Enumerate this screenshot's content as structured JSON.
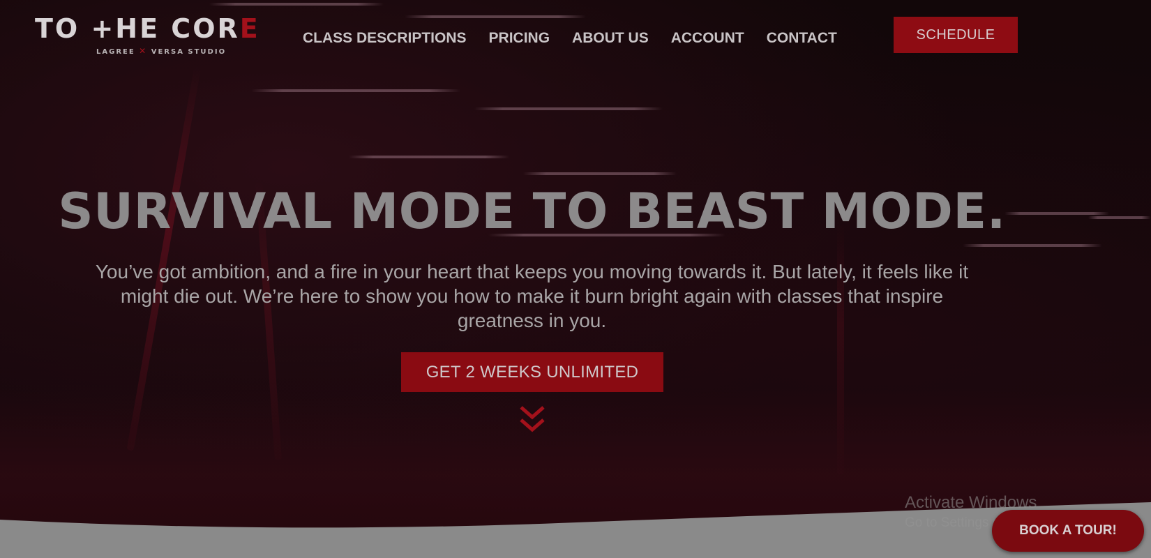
{
  "header": {
    "logo": {
      "main_left": "TO ",
      "main_the": "+HE",
      "main_co": " COR",
      "main_e": "E",
      "sub_left": "LAGREE",
      "sub_x": "✕",
      "sub_right": "VERSA STUDIO"
    },
    "nav": [
      {
        "label": "CLASS DESCRIPTIONS"
      },
      {
        "label": "PRICING"
      },
      {
        "label": "ABOUT US"
      },
      {
        "label": "ACCOUNT"
      },
      {
        "label": "CONTACT"
      }
    ],
    "schedule_label": "SCHEDULE"
  },
  "hero": {
    "headline": "SURVIVAL MODE TO BEAST MODE.",
    "subtext_lines": [
      "You’ve got ambition, and a fire in your heart that keeps you moving towards it. But lately, it feels like it",
      "might die out. We’re here to show you how to make it burn bright again with classes that inspire",
      "greatness in you."
    ],
    "cta_label": "GET 2 WEEKS UNLIMITED",
    "scroll_icon": "double-chevron-down-icon"
  },
  "watermark": {
    "title": "Activate Windows",
    "subtitle": "Go to Settings to activate Windows."
  },
  "floating": {
    "tour_label": "BOOK A TOUR!"
  },
  "colors": {
    "brand_red": "#8e0c13",
    "button_red_dark": "#7b0a10",
    "nav_text": "#c9c4c6",
    "headline_text": "#8c8a8b",
    "background": "#120709"
  }
}
